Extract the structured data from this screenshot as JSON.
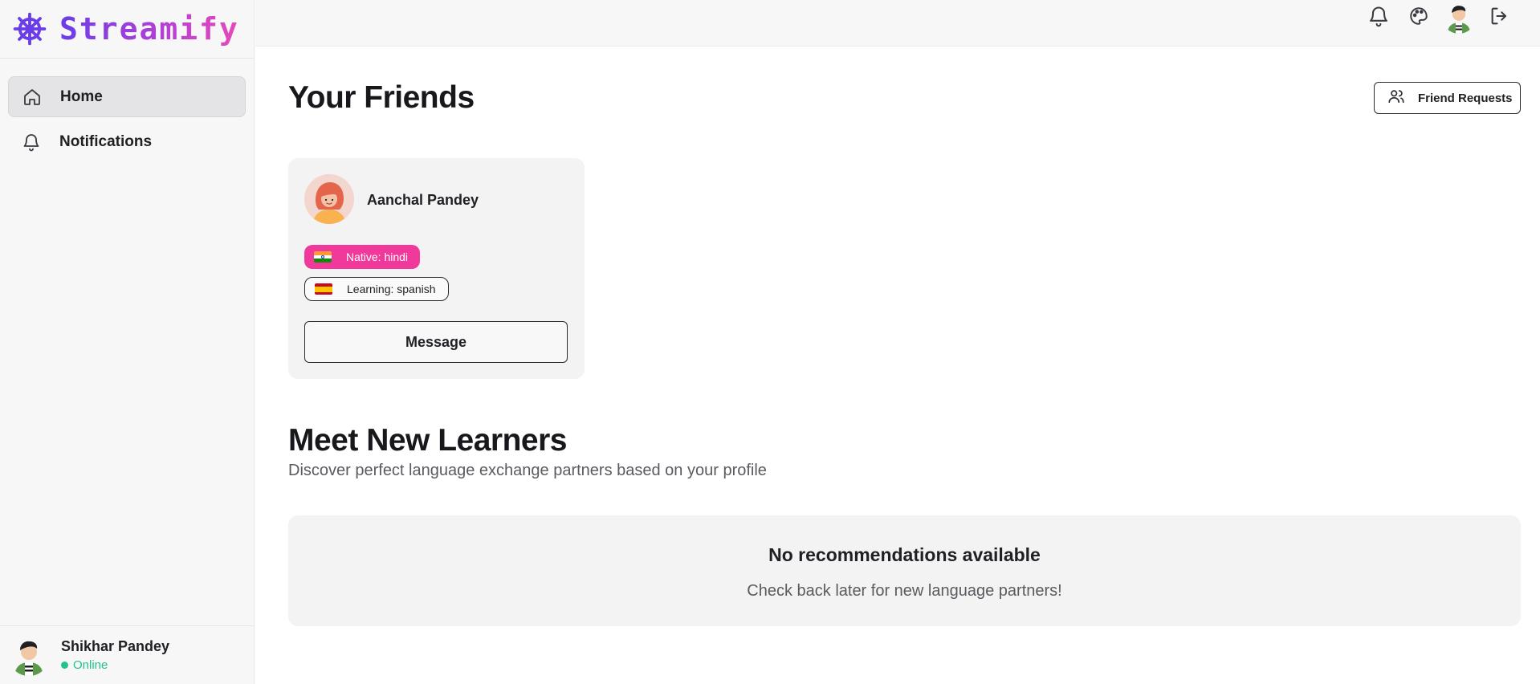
{
  "app": {
    "name": "Streamify",
    "accent": "#7b3fe4",
    "pink": "#f0399b"
  },
  "sidebar": {
    "items": [
      {
        "label": "Home",
        "icon": "home-icon",
        "active": true
      },
      {
        "label": "Notifications",
        "icon": "bell-icon",
        "active": false
      }
    ],
    "user": {
      "name": "Shikhar Pandey",
      "status": "Online"
    }
  },
  "topbar": {
    "icons": [
      "bell-icon",
      "palette-icon",
      "avatar",
      "logout-icon"
    ]
  },
  "friends": {
    "title": "Your Friends",
    "requests_label": "Friend Requests",
    "cards": [
      {
        "name": "Aanchal Pandey",
        "native": "Native: hindi",
        "learning": "Learning: spanish",
        "message_label": "Message"
      }
    ]
  },
  "learners": {
    "title": "Meet New Learners",
    "subtitle": "Discover perfect language exchange partners based on your profile",
    "empty_title": "No recommendations available",
    "empty_subtitle": "Check back later for new language partners!"
  }
}
